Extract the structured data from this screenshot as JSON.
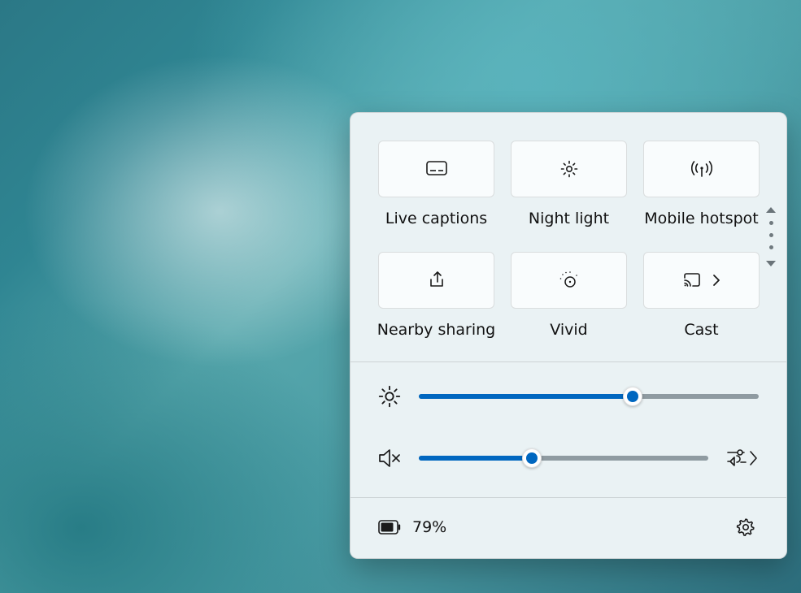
{
  "quick_settings": {
    "tiles": [
      {
        "id": "live-captions",
        "label": "Live captions"
      },
      {
        "id": "night-light",
        "label": "Night light"
      },
      {
        "id": "mobile-hotspot",
        "label": "Mobile hotspot"
      },
      {
        "id": "nearby-sharing",
        "label": "Nearby sharing"
      },
      {
        "id": "vivid",
        "label": "Vivid"
      },
      {
        "id": "cast",
        "label": "Cast"
      }
    ],
    "brightness": {
      "value": 63
    },
    "volume": {
      "value": 39,
      "muted": true
    },
    "battery": {
      "percent_label": "79%"
    },
    "accent_color": "#0067c0"
  }
}
